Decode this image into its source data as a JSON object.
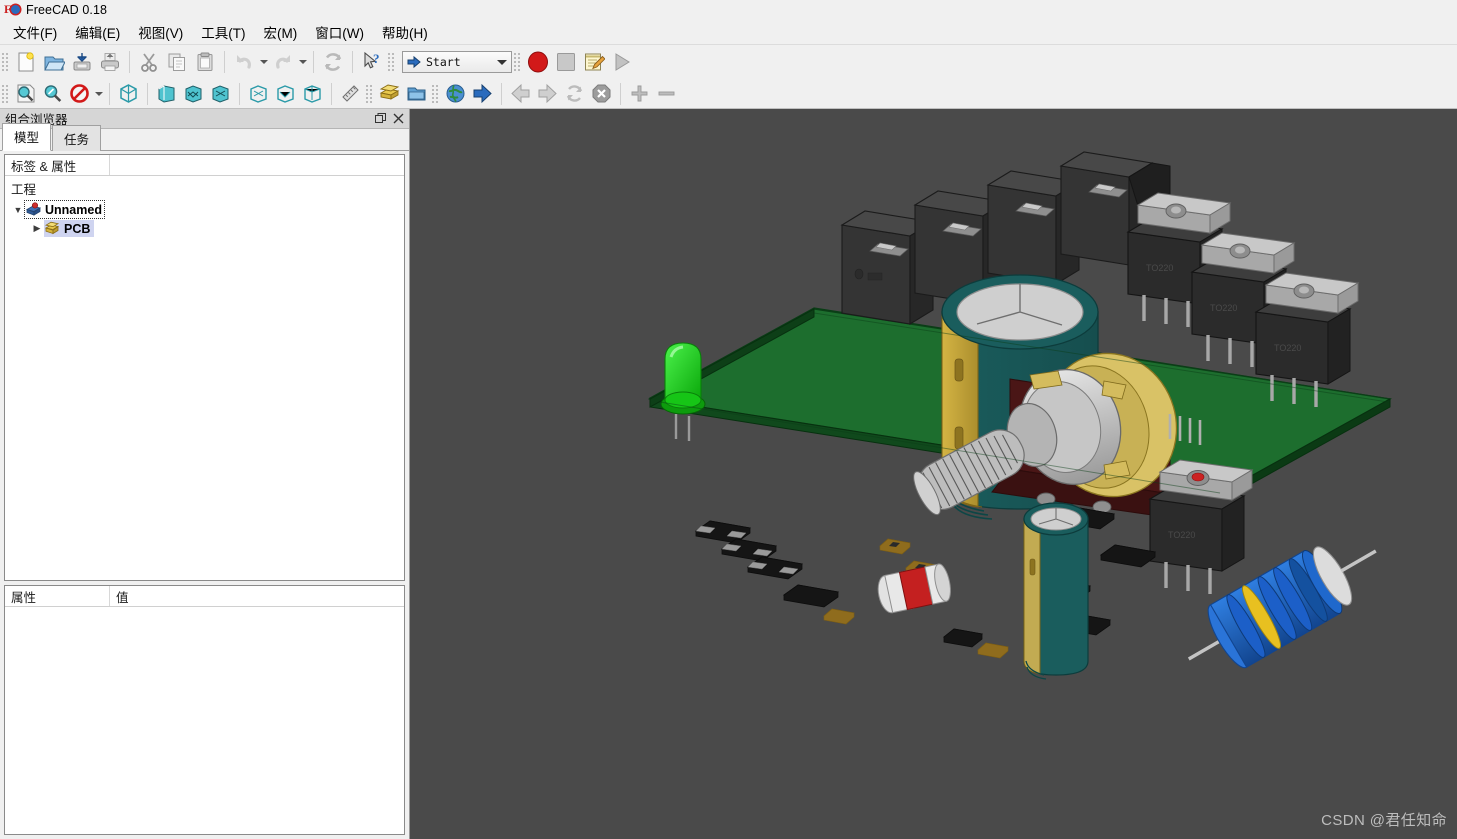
{
  "window": {
    "title": "FreeCAD 0.18",
    "icon": "freecad-logo-icon"
  },
  "menubar": {
    "items": [
      {
        "label": "文件(F)",
        "name": "menu-file"
      },
      {
        "label": "编辑(E)",
        "name": "menu-edit"
      },
      {
        "label": "视图(V)",
        "name": "menu-view"
      },
      {
        "label": "工具(T)",
        "name": "menu-tools"
      },
      {
        "label": "宏(M)",
        "name": "menu-macro"
      },
      {
        "label": "窗口(W)",
        "name": "menu-window"
      },
      {
        "label": "帮助(H)",
        "name": "menu-help"
      }
    ]
  },
  "toolbars": {
    "file": {
      "buttons": [
        {
          "name": "new-document-icon",
          "tooltip": "New"
        },
        {
          "name": "open-document-icon",
          "tooltip": "Open"
        },
        {
          "name": "save-document-icon",
          "tooltip": "Save"
        },
        {
          "name": "print-document-icon",
          "tooltip": "Print"
        },
        {
          "name": "cut-icon",
          "tooltip": "Cut"
        },
        {
          "name": "copy-icon",
          "tooltip": "Copy"
        },
        {
          "name": "paste-icon",
          "tooltip": "Paste"
        },
        {
          "name": "undo-icon",
          "tooltip": "Undo"
        },
        {
          "name": "redo-icon",
          "tooltip": "Redo"
        },
        {
          "name": "refresh-icon",
          "tooltip": "Refresh"
        },
        {
          "name": "whats-this-icon",
          "tooltip": "What's This?"
        }
      ]
    },
    "workbench": {
      "selected": "Start",
      "icon": "workbench-start-icon"
    },
    "macro": {
      "buttons": [
        {
          "name": "macro-record-icon",
          "tooltip": "Macro recording"
        },
        {
          "name": "macro-stop-icon",
          "tooltip": "Stop macro recording"
        },
        {
          "name": "macro-edit-icon",
          "tooltip": "Macros"
        },
        {
          "name": "macro-execute-icon",
          "tooltip": "Execute macro"
        }
      ]
    },
    "view": {
      "buttons": [
        {
          "name": "fit-all-icon",
          "tooltip": "Fit all"
        },
        {
          "name": "fit-selection-icon",
          "tooltip": "Fit selection"
        },
        {
          "name": "draw-style-icon",
          "tooltip": "Draw style"
        },
        {
          "name": "axonometric-view-icon",
          "tooltip": "Axonometric"
        },
        {
          "name": "front-view-icon",
          "tooltip": "Front"
        },
        {
          "name": "top-view-icon",
          "tooltip": "Top"
        },
        {
          "name": "right-view-icon",
          "tooltip": "Right"
        },
        {
          "name": "rear-view-icon",
          "tooltip": "Rear"
        },
        {
          "name": "bottom-view-icon",
          "tooltip": "Bottom"
        },
        {
          "name": "left-view-icon",
          "tooltip": "Left"
        },
        {
          "name": "measure-icon",
          "tooltip": "Measure"
        }
      ]
    },
    "structure": {
      "buttons": [
        {
          "name": "create-part-icon",
          "tooltip": "Create part"
        },
        {
          "name": "create-group-icon",
          "tooltip": "Create group"
        }
      ]
    },
    "navigation": {
      "buttons": [
        {
          "name": "web-home-icon",
          "tooltip": "Start page"
        },
        {
          "name": "goto-link-icon",
          "tooltip": "Go to link"
        },
        {
          "name": "nav-back-icon",
          "tooltip": "Previous page"
        },
        {
          "name": "nav-forward-icon",
          "tooltip": "Next page"
        },
        {
          "name": "nav-reload-icon",
          "tooltip": "Refresh web page"
        },
        {
          "name": "nav-stop-icon",
          "tooltip": "Stop loading"
        },
        {
          "name": "zoom-in-icon",
          "tooltip": "Zoom in"
        },
        {
          "name": "zoom-out-icon",
          "tooltip": "Zoom out"
        }
      ]
    }
  },
  "left_dock": {
    "title": "组合浏览器",
    "float_button": "float-icon",
    "close_button": "close-icon",
    "tabs": [
      {
        "label": "模型",
        "name": "tab-model",
        "active": true
      },
      {
        "label": "任务",
        "name": "tab-tasks",
        "active": false
      }
    ],
    "tree": {
      "header": {
        "col1": "标签 & 属性",
        "col2": ""
      },
      "project_label": "工程",
      "nodes": [
        {
          "label": "Unnamed",
          "icon": "document-icon",
          "twisty": "expanded",
          "state": "focused",
          "indent": "root"
        },
        {
          "label": "PCB",
          "icon": "part-icon",
          "twisty": "collapsed",
          "state": "selected",
          "indent": "child"
        }
      ]
    },
    "properties": {
      "header": {
        "name_col": "属性",
        "value_col": "值"
      },
      "rows": []
    }
  },
  "viewport": {
    "background_color": "#4a4a4a",
    "watermark": "CSDN @君任知命",
    "model": {
      "name": "PCB amplifier board",
      "board_color": "#1f6b2e",
      "components": [
        {
          "name": "electrolytic-capacitor-large",
          "colors": [
            "#1d5c5c",
            "#c6a83b",
            "#d0d0d0"
          ]
        },
        {
          "name": "potentiometer",
          "colors": [
            "#c8c8c8",
            "#c6a83b",
            "#5a1f1f"
          ]
        },
        {
          "name": "led-green",
          "colors": [
            "#18d718"
          ]
        },
        {
          "name": "terminal-block",
          "colors": [
            "#2a2a2a"
          ]
        },
        {
          "name": "relay-block",
          "colors": [
            "#2f2f2f"
          ]
        },
        {
          "name": "to220-transistor",
          "colors": [
            "#2b2b2b",
            "#b8b8b8"
          ]
        },
        {
          "name": "smd-resistor",
          "colors": [
            "#1a1a1a"
          ]
        },
        {
          "name": "power-resistor-blue",
          "colors": [
            "#1c5fc8",
            "#e8c020"
          ]
        },
        {
          "name": "diode",
          "colors": [
            "#c42020",
            "#e8e8e8"
          ]
        },
        {
          "name": "electrolytic-capacitor-small",
          "colors": [
            "#1d5c5c",
            "#c6a83b"
          ]
        }
      ]
    }
  }
}
